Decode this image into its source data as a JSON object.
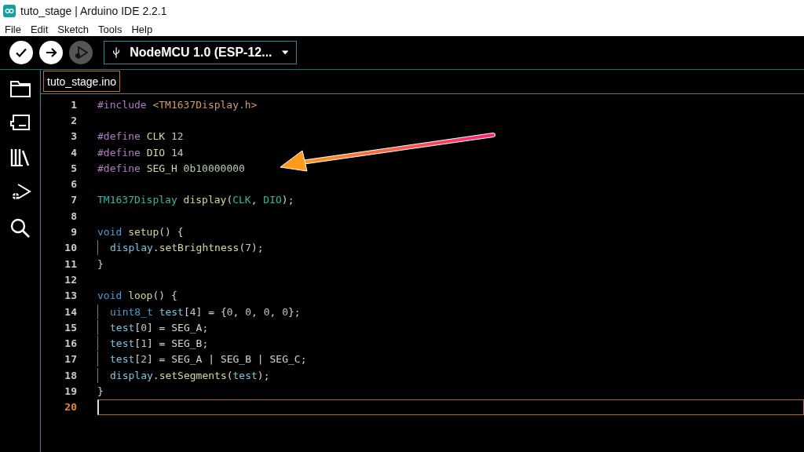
{
  "window": {
    "title": "tuto_stage | Arduino IDE 2.2.1"
  },
  "menu": [
    "File",
    "Edit",
    "Sketch",
    "Tools",
    "Help"
  ],
  "toolbar": {
    "buttons": [
      {
        "kind": "verify",
        "disabled": false
      },
      {
        "kind": "upload",
        "disabled": false
      },
      {
        "kind": "debug",
        "disabled": true
      }
    ],
    "board": "NodeMCU 1.0 (ESP-12..."
  },
  "sidebar": [
    {
      "kind": "folder"
    },
    {
      "kind": "boards"
    },
    {
      "kind": "library"
    },
    {
      "kind": "debug"
    },
    {
      "kind": "search"
    }
  ],
  "tabs": [
    {
      "label": "tuto_stage.ino",
      "selected": true
    }
  ],
  "editor": {
    "lines": [
      {
        "number": "1",
        "current": false,
        "indent": false,
        "tokens": [
          {
            "kind": "directive",
            "text": "#include "
          },
          {
            "kind": "string",
            "text": "<TM1637Display.h>"
          }
        ]
      },
      {
        "number": "2",
        "current": false,
        "indent": false
      },
      {
        "number": "3",
        "current": false,
        "indent": false,
        "tokens": [
          {
            "kind": "directive",
            "text": "#define "
          },
          {
            "kind": "macro",
            "text": "CLK "
          },
          {
            "kind": "number",
            "text": "12"
          }
        ]
      },
      {
        "number": "4",
        "current": false,
        "indent": false,
        "tokens": [
          {
            "kind": "directive",
            "text": "#define "
          },
          {
            "kind": "macro",
            "text": "DIO "
          },
          {
            "kind": "number",
            "text": "14"
          }
        ]
      },
      {
        "number": "5",
        "current": false,
        "indent": false,
        "tokens": [
          {
            "kind": "directive",
            "text": "#define "
          },
          {
            "kind": "macro",
            "text": "SEG_H "
          },
          {
            "kind": "number",
            "text": "0b10000000"
          }
        ]
      },
      {
        "number": "6",
        "current": false,
        "indent": false
      },
      {
        "number": "7",
        "current": false,
        "indent": false,
        "tokens": [
          {
            "kind": "type",
            "text": "TM1637Display "
          },
          {
            "kind": "function",
            "text": "display"
          },
          {
            "kind": "plain",
            "text": "("
          },
          {
            "kind": "type",
            "text": "CLK"
          },
          {
            "kind": "plain",
            "text": ", "
          },
          {
            "kind": "type",
            "text": "DIO"
          },
          {
            "kind": "plain",
            "text": ");"
          }
        ]
      },
      {
        "number": "8",
        "current": false,
        "indent": false
      },
      {
        "number": "9",
        "current": false,
        "indent": false,
        "tokens": [
          {
            "kind": "keyword",
            "text": "void "
          },
          {
            "kind": "function",
            "text": "setup"
          },
          {
            "kind": "plain",
            "text": "() {"
          }
        ]
      },
      {
        "number": "10",
        "current": false,
        "indent": true,
        "tokens": [
          {
            "kind": "variable",
            "text": "display"
          },
          {
            "kind": "plain",
            "text": "."
          },
          {
            "kind": "function",
            "text": "setBrightness"
          },
          {
            "kind": "plain",
            "text": "("
          },
          {
            "kind": "number",
            "text": "7"
          },
          {
            "kind": "plain",
            "text": ");"
          }
        ]
      },
      {
        "number": "11",
        "current": false,
        "indent": false,
        "tokens": [
          {
            "kind": "plain",
            "text": "}"
          }
        ]
      },
      {
        "number": "12",
        "current": false,
        "indent": false
      },
      {
        "number": "13",
        "current": false,
        "indent": false,
        "tokens": [
          {
            "kind": "keyword",
            "text": "void "
          },
          {
            "kind": "function",
            "text": "loop"
          },
          {
            "kind": "plain",
            "text": "() {"
          }
        ]
      },
      {
        "number": "14",
        "current": false,
        "indent": true,
        "tokens": [
          {
            "kind": "keyword",
            "text": "uint8_t "
          },
          {
            "kind": "variable",
            "text": "test"
          },
          {
            "kind": "plain",
            "text": "["
          },
          {
            "kind": "number",
            "text": "4"
          },
          {
            "kind": "plain",
            "text": "] = {"
          },
          {
            "kind": "number",
            "text": "0"
          },
          {
            "kind": "plain",
            "text": ", "
          },
          {
            "kind": "number",
            "text": "0"
          },
          {
            "kind": "plain",
            "text": ", "
          },
          {
            "kind": "number",
            "text": "0"
          },
          {
            "kind": "plain",
            "text": ", "
          },
          {
            "kind": "number",
            "text": "0"
          },
          {
            "kind": "plain",
            "text": "};"
          }
        ]
      },
      {
        "number": "15",
        "current": false,
        "indent": true,
        "tokens": [
          {
            "kind": "variable",
            "text": "test"
          },
          {
            "kind": "plain",
            "text": "["
          },
          {
            "kind": "number",
            "text": "0"
          },
          {
            "kind": "plain",
            "text": "] = SEG_A;"
          }
        ]
      },
      {
        "number": "16",
        "current": false,
        "indent": true,
        "tokens": [
          {
            "kind": "variable",
            "text": "test"
          },
          {
            "kind": "plain",
            "text": "["
          },
          {
            "kind": "number",
            "text": "1"
          },
          {
            "kind": "plain",
            "text": "] = SEG_B;"
          }
        ]
      },
      {
        "number": "17",
        "current": false,
        "indent": true,
        "tokens": [
          {
            "kind": "variable",
            "text": "test"
          },
          {
            "kind": "plain",
            "text": "["
          },
          {
            "kind": "number",
            "text": "2"
          },
          {
            "kind": "plain",
            "text": "] = SEG_A | SEG_B | SEG_C;"
          }
        ]
      },
      {
        "number": "18",
        "current": false,
        "indent": true,
        "tokens": [
          {
            "kind": "variable",
            "text": "display"
          },
          {
            "kind": "plain",
            "text": "."
          },
          {
            "kind": "function",
            "text": "setSegments"
          },
          {
            "kind": "plain",
            "text": "("
          },
          {
            "kind": "variable",
            "text": "test"
          },
          {
            "kind": "plain",
            "text": ");"
          }
        ]
      },
      {
        "number": "19",
        "current": false,
        "indent": false,
        "tokens": [
          {
            "kind": "plain",
            "text": "}"
          }
        ]
      },
      {
        "number": "20",
        "current": true,
        "indent": false
      }
    ]
  }
}
